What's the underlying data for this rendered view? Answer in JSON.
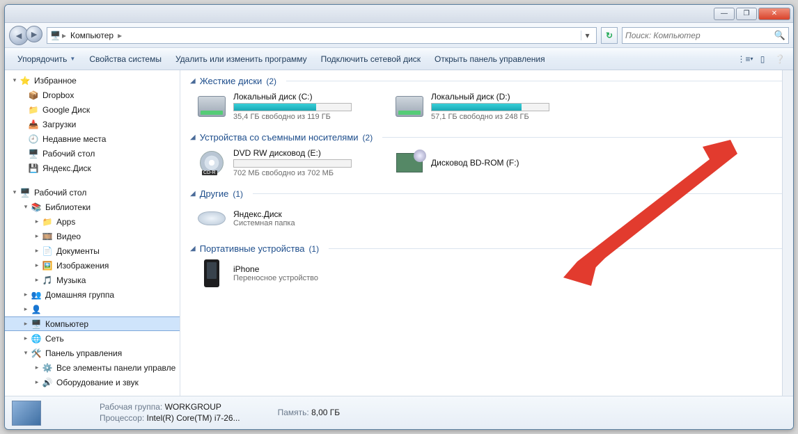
{
  "window": {
    "title": ""
  },
  "address": {
    "root": "Компьютер"
  },
  "search": {
    "placeholder": "Поиск: Компьютер"
  },
  "toolbar": {
    "organize": "Упорядочить",
    "system_props": "Свойства системы",
    "uninstall_change": "Удалить или изменить программу",
    "map_drive": "Подключить сетевой диск",
    "control_panel": "Открыть панель управления"
  },
  "sidebar": {
    "favorites": "Избранное",
    "items_fav": [
      "Dropbox",
      "Google Диск",
      "Загрузки",
      "Недавние места",
      "Рабочий стол",
      "Яндекс.Диск"
    ],
    "desktop": "Рабочий стол",
    "libraries": "Библиотеки",
    "lib_items": [
      "Apps",
      "Видео",
      "Документы",
      "Изображения",
      "Музыка"
    ],
    "homegroup": "Домашняя группа",
    "blank_user": "",
    "computer": "Компьютер",
    "network": "Сеть",
    "cp": "Панель управления",
    "cp_all": "Все элементы панели управле",
    "cp_hw": "Оборудование и звук"
  },
  "groups": {
    "hdd": {
      "title": "Жесткие диски",
      "count": "(2)"
    },
    "removable": {
      "title": "Устройства со съемными носителями",
      "count": "(2)"
    },
    "other": {
      "title": "Другие",
      "count": "(1)"
    },
    "portable": {
      "title": "Портативные устройства",
      "count": "(1)"
    }
  },
  "drives": {
    "c": {
      "name": "Локальный диск (C:)",
      "free": "35,4 ГБ свободно из 119 ГБ",
      "fill_pct": 70
    },
    "d": {
      "name": "Локальный диск (D:)",
      "free": "57,1 ГБ свободно из 248 ГБ",
      "fill_pct": 77
    },
    "e": {
      "name": "DVD RW дисковод (E:)",
      "free": "702 МБ свободно из 702 МБ",
      "fill_pct": 0
    },
    "f": {
      "name": "Дисковод BD-ROM (F:)"
    },
    "yd": {
      "name": "Яндекс.Диск",
      "sub": "Системная папка"
    },
    "iphone": {
      "name": "iPhone",
      "sub": "Переносное устройство"
    }
  },
  "status": {
    "workgroup_label": "Рабочая группа:",
    "workgroup": "WORKGROUP",
    "cpu_label": "Процессор:",
    "cpu": "Intel(R) Core(TM) i7-26...",
    "mem_label": "Память:",
    "mem": "8,00 ГБ"
  }
}
